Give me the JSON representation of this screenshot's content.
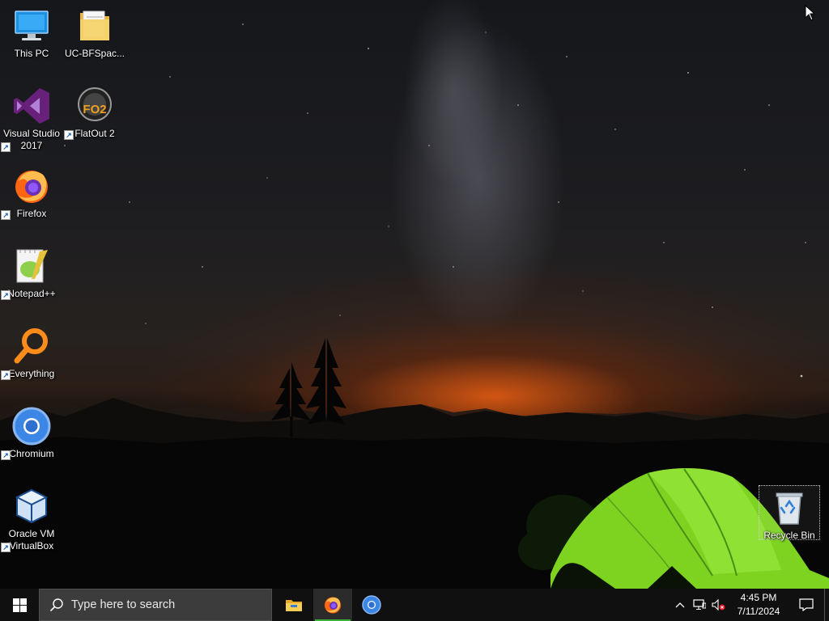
{
  "desktop": {
    "icons": [
      {
        "label": "This PC",
        "icon": "computer-icon",
        "shortcut": false
      },
      {
        "label": "UC-BFSpac...",
        "icon": "folder-icon",
        "shortcut": false
      },
      {
        "label": "Visual Studio 2017",
        "icon": "visual-studio-icon",
        "shortcut": true
      },
      {
        "label": "FlatOut 2",
        "icon": "flatout2-icon",
        "shortcut": true
      },
      {
        "label": "Firefox",
        "icon": "firefox-icon",
        "shortcut": true
      },
      {
        "label": "Notepad++",
        "icon": "notepadpp-icon",
        "shortcut": true
      },
      {
        "label": "Everything",
        "icon": "everything-icon",
        "shortcut": true
      },
      {
        "label": "Chromium",
        "icon": "chromium-icon",
        "shortcut": true
      },
      {
        "label": "Oracle VM VirtualBox",
        "icon": "virtualbox-icon",
        "shortcut": true
      },
      {
        "label": "Recycle Bin",
        "icon": "recycle-bin-icon",
        "shortcut": false,
        "selected": true
      }
    ]
  },
  "taskbar": {
    "search_placeholder": "Type here to search",
    "pinned": [
      {
        "name": "File Explorer",
        "icon": "file-explorer-icon",
        "running": false
      },
      {
        "name": "Firefox",
        "icon": "firefox-icon",
        "running": true,
        "active": true
      },
      {
        "name": "Chromium",
        "icon": "chromium-icon",
        "running": false
      }
    ],
    "tray": {
      "icons": [
        "chevron-up-icon",
        "network-icon",
        "volume-muted-icon"
      ],
      "time": "4:45 PM",
      "date": "7/11/2024"
    }
  },
  "colors": {
    "taskbar": "#101010",
    "search_box": "#3c3c3c",
    "running_indicator": "#38b03a",
    "tent": "#7ed321"
  }
}
